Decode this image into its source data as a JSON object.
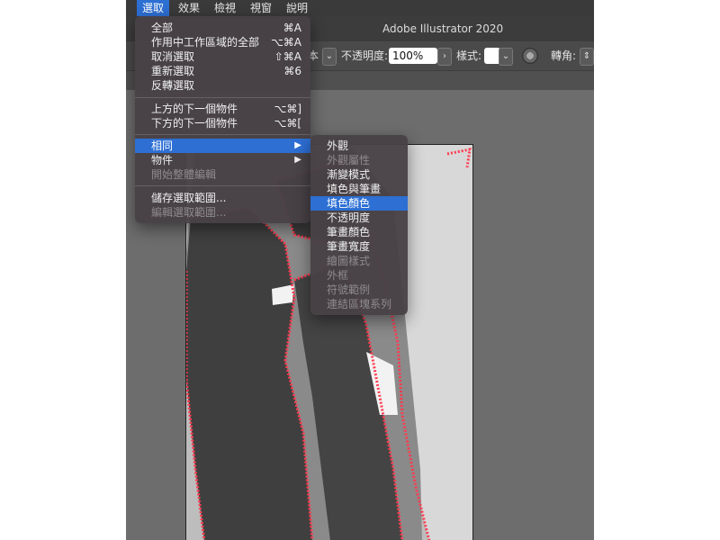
{
  "menubar": {
    "items": [
      "選取",
      "效果",
      "檢視",
      "視窗",
      "說明"
    ],
    "active_index": 0
  },
  "titlebar": {
    "title": "Adobe Illustrator 2020"
  },
  "controlbar": {
    "opacity_label": "不透明度:",
    "opacity_value": "100%",
    "style_label": "樣式:",
    "corner_label": "轉角:",
    "partial_label": "本"
  },
  "select_menu": {
    "items": [
      {
        "label": "全部",
        "shortcut": "⌘A",
        "disabled": false
      },
      {
        "label": "作用中工作區域的全部",
        "shortcut": "⌥⌘A",
        "disabled": false
      },
      {
        "label": "取消選取",
        "shortcut": "⇧⌘A",
        "disabled": false
      },
      {
        "label": "重新選取",
        "shortcut": "⌘6",
        "disabled": false
      },
      {
        "label": "反轉選取",
        "shortcut": "",
        "disabled": false
      },
      {
        "label": "上方的下一個物件",
        "shortcut": "⌥⌘]",
        "disabled": false
      },
      {
        "label": "下方的下一個物件",
        "shortcut": "⌥⌘[",
        "disabled": false
      },
      {
        "label": "相同",
        "shortcut": "",
        "disabled": false,
        "submenu": true,
        "highlighted": true
      },
      {
        "label": "物件",
        "shortcut": "",
        "disabled": false,
        "submenu": true
      },
      {
        "label": "開始整體編輯",
        "shortcut": "",
        "disabled": true
      },
      {
        "label": "儲存選取範圍...",
        "shortcut": "",
        "disabled": false
      },
      {
        "label": "編輯選取範圍...",
        "shortcut": "",
        "disabled": true
      }
    ]
  },
  "same_submenu": {
    "items": [
      {
        "label": "外觀",
        "disabled": false
      },
      {
        "label": "外觀屬性",
        "disabled": true
      },
      {
        "label": "漸變模式",
        "disabled": false
      },
      {
        "label": "填色與筆畫",
        "disabled": false
      },
      {
        "label": "填色顏色",
        "disabled": false,
        "highlighted": true
      },
      {
        "label": "不透明度",
        "disabled": false
      },
      {
        "label": "筆畫顏色",
        "disabled": false
      },
      {
        "label": "筆畫寬度",
        "disabled": false
      },
      {
        "label": "繪圖樣式",
        "disabled": true
      },
      {
        "label": "外框",
        "disabled": true
      },
      {
        "label": "符號範例",
        "disabled": true
      },
      {
        "label": "連結區塊系列",
        "disabled": true
      }
    ]
  },
  "colors": {
    "highlight": "#2d6fd3",
    "selection_path": "#ff3b4f",
    "dark_fill": "#3f3f3f",
    "mid_fill": "#8a8a8a",
    "light_fill": "#d6d6d6"
  }
}
